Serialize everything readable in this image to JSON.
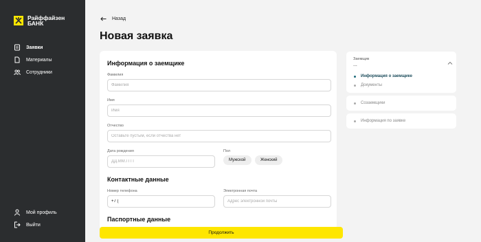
{
  "sidebar": {
    "logo": {
      "line1": "Райффайзен",
      "line2": "БАНК"
    },
    "items": [
      {
        "label": "Заявки",
        "icon": "document-icon",
        "active": true
      },
      {
        "label": "Материалы",
        "icon": "file-icon",
        "active": false
      },
      {
        "label": "Сотрудники",
        "icon": "users-icon",
        "active": false
      }
    ],
    "bottom": [
      {
        "label": "Мой профиль",
        "icon": "user-icon"
      },
      {
        "label": "Выйти",
        "icon": "logout-icon"
      }
    ]
  },
  "header": {
    "back_label": "Назад",
    "title": "Новая заявка"
  },
  "form": {
    "borrower": {
      "title": "Информация о заемщике",
      "lastname": {
        "label": "Фамилия",
        "placeholder": "Фамилия"
      },
      "firstname": {
        "label": "Имя",
        "placeholder": "Имя"
      },
      "patronymic": {
        "label": "Отчество",
        "placeholder": "Оставьте пустым, если отчества нет"
      },
      "birthdate": {
        "label": "Дата рождения",
        "placeholder": "ДД.ММ.ГГГГ"
      },
      "gender": {
        "label": "Пол",
        "options": [
          "Мужской",
          "Женский"
        ]
      }
    },
    "contacts": {
      "title": "Контактные данные",
      "phone": {
        "label": "Номер телефона",
        "value": "+7 ("
      },
      "email": {
        "label": "Электронная почта",
        "placeholder": "Адрес электронной почты"
      }
    },
    "passport": {
      "title": "Паспортные данные"
    }
  },
  "steps": {
    "borrower_label": "Заемщик",
    "borrower_value": "...",
    "substeps": [
      {
        "label": "Информация о заемщике",
        "active": true
      },
      {
        "label": "Документы",
        "active": false
      }
    ],
    "coborrowers": "Созаемщики",
    "request_info": "Информация по заявке"
  },
  "continue_label": "Продолжить",
  "colors": {
    "sidebar": "#2b2d2f",
    "accent": "#fee600",
    "active_step": "#1d4d5c"
  }
}
